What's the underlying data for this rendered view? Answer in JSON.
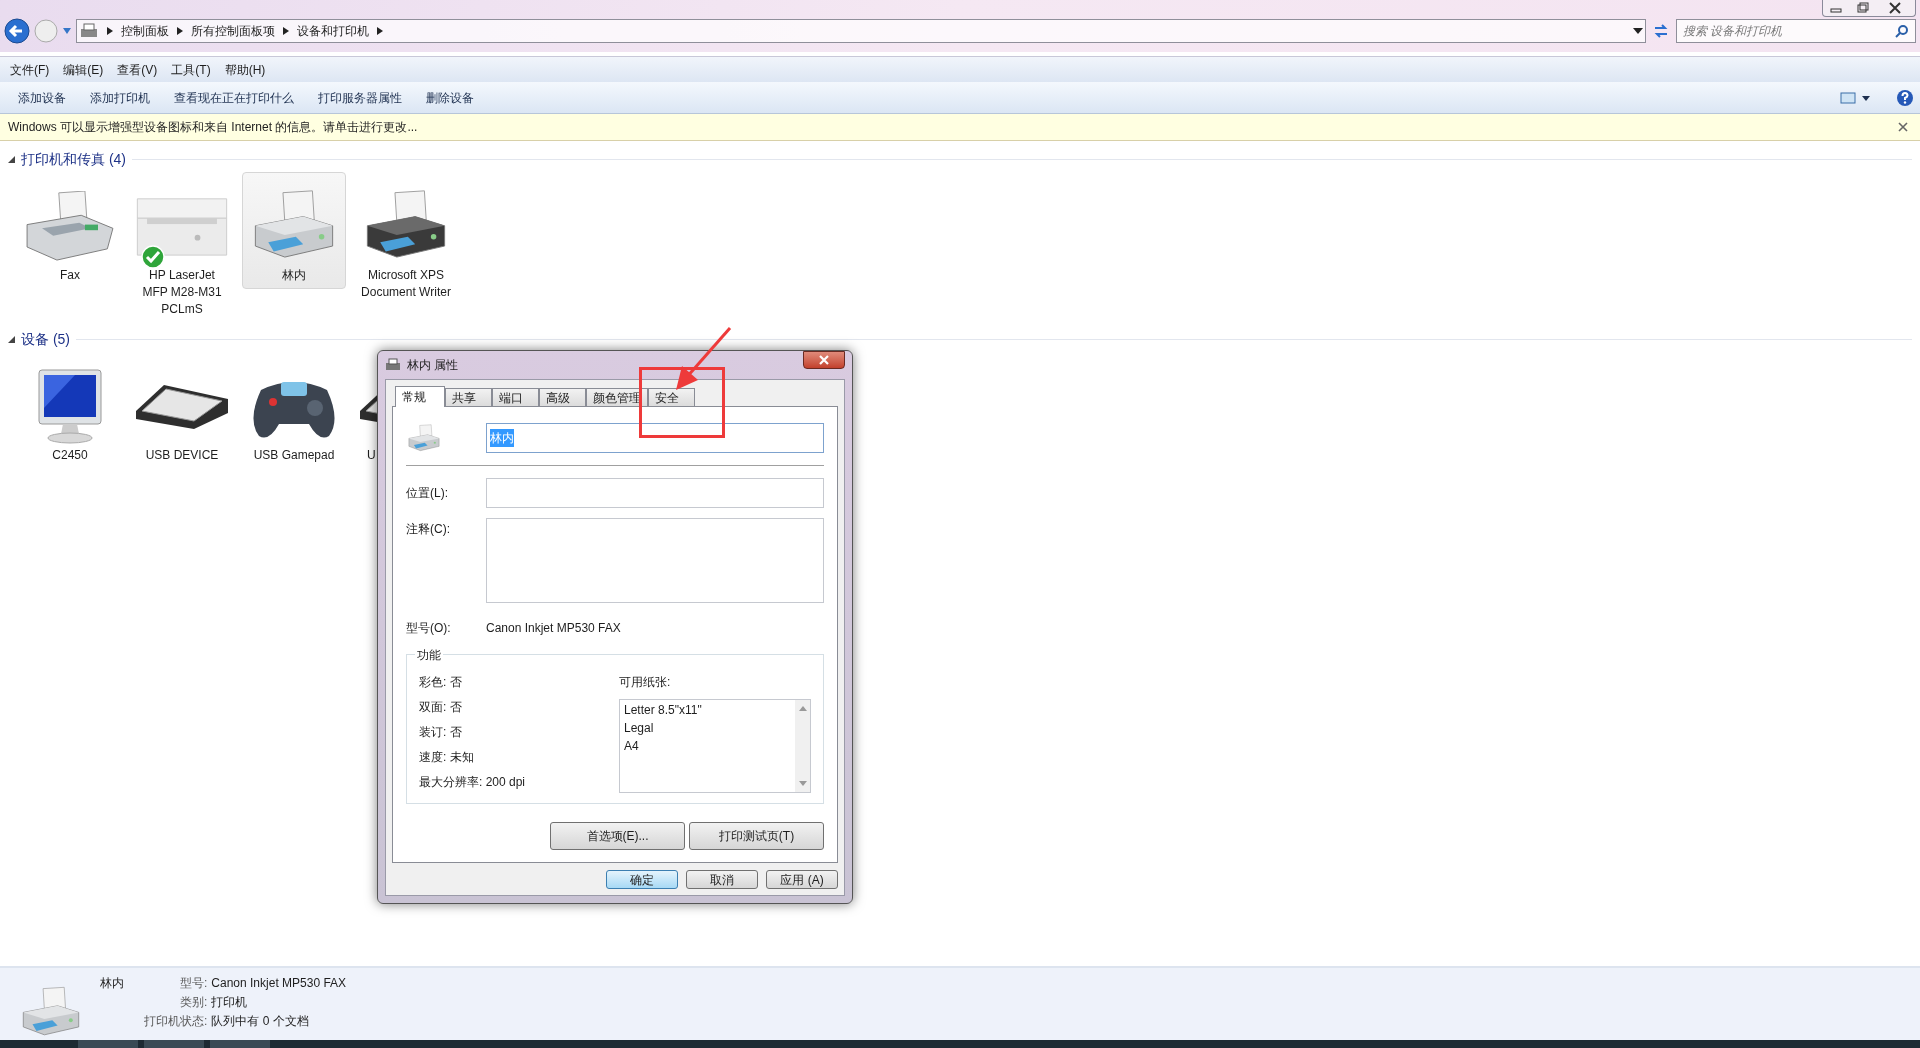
{
  "address_bar": {
    "path": [
      "控制面板",
      "所有控制面板项",
      "设备和打印机"
    ],
    "search_placeholder": "搜索 设备和打印机"
  },
  "menu": [
    "文件(F)",
    "编辑(E)",
    "查看(V)",
    "工具(T)",
    "帮助(H)"
  ],
  "toolbar": [
    "添加设备",
    "添加打印机",
    "查看现在正在打印什么",
    "打印服务器属性",
    "删除设备"
  ],
  "info_bar": {
    "text": "Windows 可以显示增强型设备图标和来自 Internet 的信息。请单击进行更改..."
  },
  "groups": [
    {
      "title": "打印机和传真 (4)",
      "expanded": true,
      "items": [
        {
          "kind": "fax",
          "label": "Fax",
          "selected": false,
          "default": false
        },
        {
          "kind": "laser",
          "label": "HP LaserJet MFP M28-M31 PCLmS",
          "selected": false,
          "default": true
        },
        {
          "kind": "printer",
          "label": "林内",
          "selected": true,
          "default": false
        },
        {
          "kind": "printer_dark",
          "label": "Microsoft XPS Document Writer",
          "selected": false,
          "default": false
        }
      ]
    },
    {
      "title": "设备 (5)",
      "expanded": true,
      "items": [
        {
          "kind": "monitor",
          "label": "C2450",
          "selected": false,
          "default": false
        },
        {
          "kind": "keyboard",
          "label": "USB DEVICE",
          "selected": false,
          "default": false
        },
        {
          "kind": "gamepad",
          "label": "USB Gamepad",
          "selected": false,
          "default": false
        },
        {
          "kind": "keyboard",
          "label": "U",
          "selected": false,
          "default": false,
          "cut_off": true
        }
      ]
    }
  ],
  "dialog": {
    "title": "林内 属性",
    "tabs": [
      {
        "label": "常规",
        "selected": true
      },
      {
        "label": "共享",
        "selected": false
      },
      {
        "label": "端口",
        "selected": false
      },
      {
        "label": "高级",
        "selected": false
      },
      {
        "label": "颜色管理",
        "selected": false
      },
      {
        "label": "安全",
        "selected": false
      }
    ],
    "name_value": "林内",
    "name_selected": true,
    "location_label": "位置(L):",
    "comment_label": "注释(C):",
    "model_label": "型号(O):",
    "model_value": "Canon Inkjet MP530 FAX",
    "features_title": "功能",
    "features": [
      "彩色: 否",
      "双面: 否",
      "装订: 否",
      "速度: 未知",
      "最大分辨率: 200 dpi"
    ],
    "paper_label": "可用纸张:",
    "papers": [
      "Letter 8.5\"x11\"",
      "Legal",
      "A4"
    ],
    "panel_buttons": [
      "首选项(E)...",
      "打印测试页(T)"
    ],
    "footer_buttons": [
      {
        "label": "确定",
        "default": true
      },
      {
        "label": "取消",
        "default": false
      },
      {
        "label": "应用 (A)",
        "default": false
      }
    ]
  },
  "details": {
    "name": "林内",
    "rows": [
      {
        "label": "型号:",
        "value": "Canon Inkjet MP530 FAX"
      },
      {
        "label": "类别:",
        "value": "打印机"
      },
      {
        "label": "打印机状态:",
        "value": "队列中有 0 个文档"
      }
    ]
  }
}
